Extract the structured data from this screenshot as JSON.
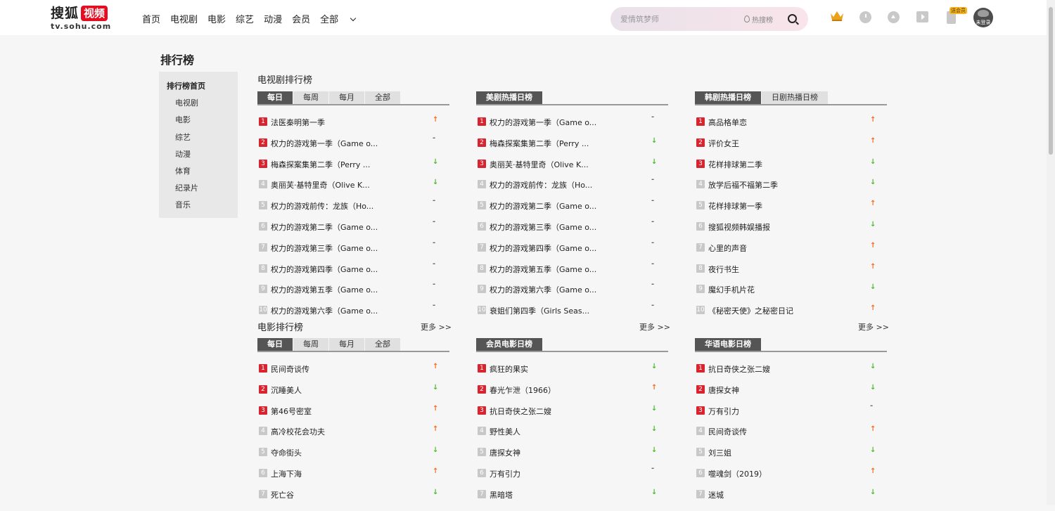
{
  "header": {
    "logo_cn": "搜狐",
    "logo_video": "视频",
    "logo_url": "tv.sohu.com",
    "nav": [
      "首页",
      "电视剧",
      "电影",
      "综艺",
      "动漫",
      "会员",
      "全部"
    ],
    "search_placeholder": "爱情筑梦师",
    "hot_search": "热搜榜",
    "badge": "送会员",
    "avatar_text": "未登录"
  },
  "page_title": "排行榜",
  "sidebar": [
    "排行榜首页",
    "电视剧",
    "电影",
    "综艺",
    "动漫",
    "体育",
    "纪录片",
    "音乐"
  ],
  "tv_section": {
    "title": "电视剧排行榜",
    "more": "更多 >>",
    "tabs": [
      "每日",
      "每周",
      "每月",
      "全部"
    ],
    "list": [
      [
        "法医秦明第一季",
        "up"
      ],
      [
        "权力的游戏第一季（Game o...",
        "same"
      ],
      [
        "梅森探案集第二季（Perry ...",
        "down"
      ],
      [
        "奥丽芙·基特里奇（Olive K...",
        "down"
      ],
      [
        "权力的游戏前传：龙族（Ho...",
        "same"
      ],
      [
        "权力的游戏第二季（Game o...",
        "same"
      ],
      [
        "权力的游戏第三季（Game o...",
        "same"
      ],
      [
        "权力的游戏第四季（Game o...",
        "same"
      ],
      [
        "权力的游戏第五季（Game o...",
        "same"
      ],
      [
        "权力的游戏第六季（Game o...",
        "same"
      ]
    ]
  },
  "us_section": {
    "tab": "美剧热播日榜",
    "more": "更多 >>",
    "list": [
      [
        "权力的游戏第一季（Game o...",
        "same"
      ],
      [
        "梅森探案集第二季（Perry ...",
        "down"
      ],
      [
        "奥丽芙·基特里奇（Olive K...",
        "down"
      ],
      [
        "权力的游戏前传：龙族（Ho...",
        "same"
      ],
      [
        "权力的游戏第二季（Game o...",
        "same"
      ],
      [
        "权力的游戏第三季（Game o...",
        "same"
      ],
      [
        "权力的游戏第四季（Game o...",
        "same"
      ],
      [
        "权力的游戏第五季（Game o...",
        "same"
      ],
      [
        "权力的游戏第六季（Game o...",
        "same"
      ],
      [
        "衰姐们第四季（Girls Seas...",
        "same"
      ]
    ]
  },
  "kr_section": {
    "tabs": [
      "韩剧热播日榜",
      "日剧热播日榜"
    ],
    "more": "更多 >>",
    "list": [
      [
        "高品格单恋",
        "up"
      ],
      [
        "评价女王",
        "up"
      ],
      [
        "花样排球第二季",
        "down"
      ],
      [
        "放学后福不福第二季",
        "down"
      ],
      [
        "花样排球第一季",
        "up"
      ],
      [
        "搜狐视频韩娱播报",
        "down"
      ],
      [
        "心里的声音",
        "up"
      ],
      [
        "夜行书生",
        "up"
      ],
      [
        "魔幻手机片花",
        "down"
      ],
      [
        "《秘密天使》之秘密日记",
        "up"
      ]
    ]
  },
  "movie_section": {
    "title": "电影排行榜",
    "tabs": [
      "每日",
      "每周",
      "每月",
      "全部"
    ],
    "list": [
      [
        "民间奇谈传",
        "up"
      ],
      [
        "沉睡美人",
        "down"
      ],
      [
        "第46号密室",
        "up"
      ],
      [
        "高冷校花会功夫",
        "up"
      ],
      [
        "夺命街头",
        "down"
      ],
      [
        "上海下海",
        "up"
      ],
      [
        "死亡谷",
        "down"
      ]
    ]
  },
  "vip_section": {
    "tab": "会员电影日榜",
    "list": [
      [
        "疯狂的果实",
        "down"
      ],
      [
        "春光乍泄（1966）",
        "up"
      ],
      [
        "抗日奇侠之张二嫂",
        "down"
      ],
      [
        "野性美人",
        "down"
      ],
      [
        "唐探女神",
        "down"
      ],
      [
        "万有引力",
        "same"
      ],
      [
        "黑暗塔",
        "down"
      ]
    ]
  },
  "cn_section": {
    "tab": "华语电影日榜",
    "list": [
      [
        "抗日奇侠之张二嫂",
        "down"
      ],
      [
        "唐探女神",
        "down"
      ],
      [
        "万有引力",
        "same"
      ],
      [
        "民间奇谈传",
        "up"
      ],
      [
        "刘三姐",
        "down"
      ],
      [
        "噬魂剑（2019）",
        "up"
      ],
      [
        "迷城",
        "down"
      ]
    ]
  },
  "trend_symbols": {
    "up": "↑",
    "down": "↓",
    "same": "-"
  },
  "colors": {
    "brand_red": "#e40c20",
    "rank_top": "#d8242f",
    "up": "#f36b22",
    "down": "#4cba2c"
  }
}
